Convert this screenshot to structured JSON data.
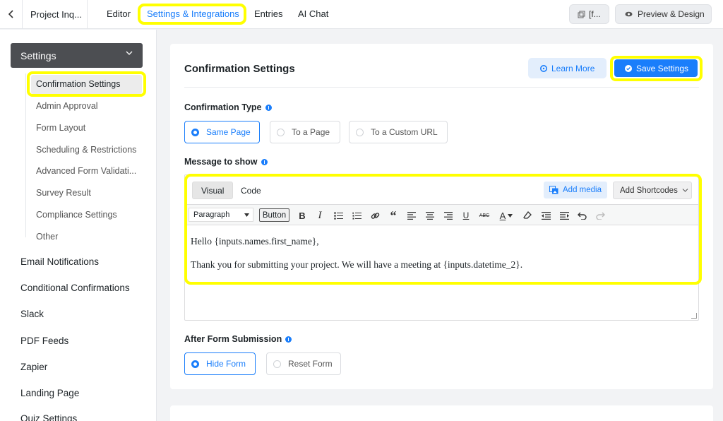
{
  "topbar": {
    "project": "Project Inq...",
    "tabs": [
      {
        "label": "Editor"
      },
      {
        "label": "Settings & Integrations"
      },
      {
        "label": "Entries"
      },
      {
        "label": "AI Chat"
      }
    ],
    "shortcode_btn": "[f...",
    "preview_btn": "Preview & Design"
  },
  "sidebar": {
    "dropdown": "Settings",
    "subitems": [
      "Confirmation Settings",
      "Admin Approval",
      "Form Layout",
      "Scheduling & Restrictions",
      "Advanced Form Validati...",
      "Survey Result",
      "Compliance Settings",
      "Other"
    ],
    "items": [
      "Email Notifications",
      "Conditional Confirmations",
      "Slack",
      "PDF Feeds",
      "Zapier",
      "Landing Page",
      "Quiz Settings"
    ]
  },
  "main": {
    "title": "Confirmation Settings",
    "learn_more": "Learn More",
    "save": "Save Settings",
    "confirmation_type_label": "Confirmation Type",
    "confirmation_options": [
      "Same Page",
      "To a Page",
      "To a Custom URL"
    ],
    "message_label": "Message to show",
    "editor": {
      "tab_visual": "Visual",
      "tab_code": "Code",
      "add_media": "Add media",
      "add_shortcodes": "Add Shortcodes",
      "paragraph": "Paragraph",
      "button": "Button",
      "line1": "Hello {inputs.names.first_name},",
      "line2": "Thank you for submitting your project. We will have a meeting at {inputs.datetime_2}."
    },
    "after_submit_label": "After Form Submission",
    "after_submit_options": [
      "Hide Form",
      "Reset Form"
    ]
  },
  "colors": {
    "accent": "#1a7efb",
    "highlight": "#ffff00",
    "dropdown_bg": "#4c4e52"
  }
}
